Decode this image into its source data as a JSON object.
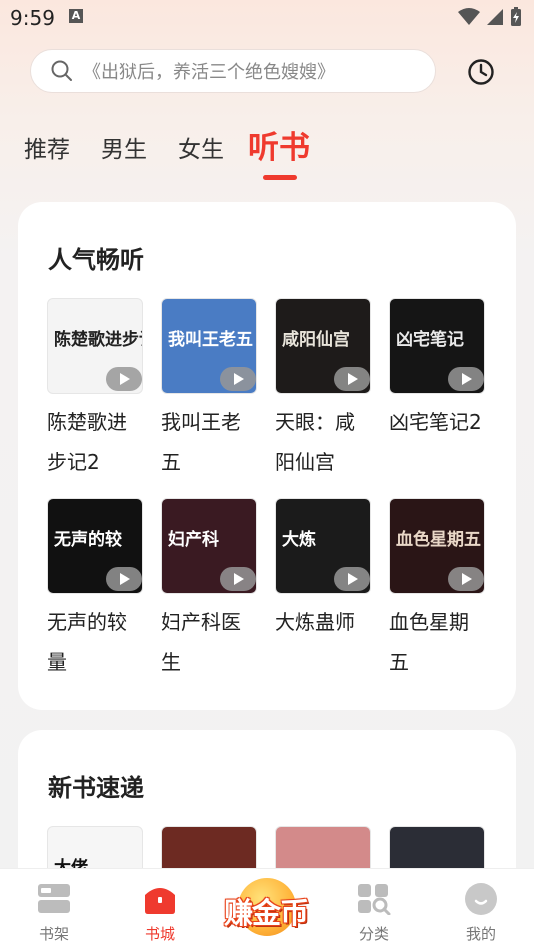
{
  "status": {
    "time": "9:59",
    "notif_icon_text": "A"
  },
  "search": {
    "placeholder": "《出狱后，养活三个绝色嫂嫂》"
  },
  "tabs": [
    {
      "label": "推荐"
    },
    {
      "label": "男生"
    },
    {
      "label": "女生"
    },
    {
      "label": "听书"
    }
  ],
  "sections": {
    "popular": {
      "title": "人气畅听",
      "books": [
        {
          "name": "陈楚歌进步记2",
          "cover_text": "陈楚歌进步记",
          "cover_bg": "#f4f4f4",
          "cover_fg": "#222"
        },
        {
          "name": "我叫王老五",
          "cover_text": "我叫王老五",
          "cover_bg": "#4a7cc4",
          "cover_fg": "#fff"
        },
        {
          "name": "天眼：咸阳仙宫",
          "cover_text": "咸阳仙宫",
          "cover_bg": "#1e1b1a",
          "cover_fg": "#e8e4da"
        },
        {
          "name": "凶宅笔记2",
          "cover_text": "凶宅笔记",
          "cover_bg": "#151515",
          "cover_fg": "#e9e9e9"
        },
        {
          "name": "无声的较量",
          "cover_text": "无声的较",
          "cover_bg": "#111111",
          "cover_fg": "#ffffff"
        },
        {
          "name": "妇产科医生",
          "cover_text": "妇产科",
          "cover_bg": "#3a1a22",
          "cover_fg": "#ffffff"
        },
        {
          "name": "大炼蛊师",
          "cover_text": "大炼",
          "cover_bg": "#1b1b1b",
          "cover_fg": "#ffffff"
        },
        {
          "name": "血色星期五",
          "cover_text": "血色星期五",
          "cover_bg": "#2a1516",
          "cover_fg": "#e9d7c7"
        }
      ]
    },
    "newbooks": {
      "title": "新书速递",
      "books": [
        {
          "cover_text": "大佬",
          "cover_bg": "#f6f6f6",
          "cover_fg": "#111"
        },
        {
          "cover_text": "",
          "cover_bg": "#6d2a22",
          "cover_fg": "#fff"
        },
        {
          "cover_text": "",
          "cover_bg": "#d38a8a",
          "cover_fg": "#fff"
        },
        {
          "cover_text": "",
          "cover_bg": "#2b2d36",
          "cover_fg": "#fff"
        }
      ]
    }
  },
  "bottom_nav": {
    "shelf": "书架",
    "store": "书城",
    "earn": "赚金币",
    "category": "分类",
    "mine": "我的"
  },
  "colors": {
    "accent": "#ef3a2e"
  }
}
